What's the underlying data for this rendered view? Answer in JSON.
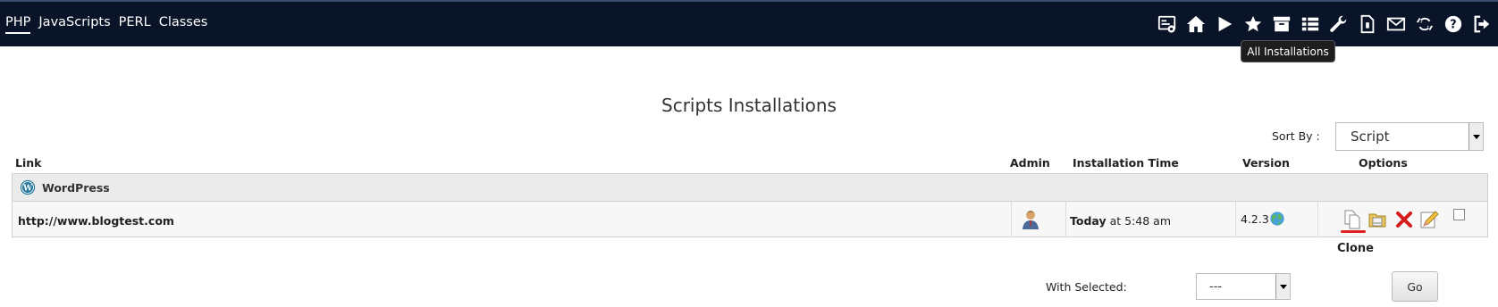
{
  "nav": {
    "tabs": [
      {
        "label": "PHP",
        "active": true
      },
      {
        "label": "JavaScripts",
        "active": false
      },
      {
        "label": "PERL",
        "active": false
      },
      {
        "label": "Classes",
        "active": false
      }
    ],
    "icons": [
      "dashboard-icon",
      "home-icon",
      "play-icon",
      "star-icon",
      "archive-icon",
      "list-icon",
      "wrench-icon",
      "file-icon",
      "mail-icon",
      "refresh-icon",
      "help-icon",
      "logout-icon"
    ],
    "colors": {
      "bar": "#0a1428"
    }
  },
  "tooltip": "All Installations",
  "page": {
    "title": "Scripts Installations"
  },
  "sort": {
    "label": "Sort By :",
    "value": "Script"
  },
  "table": {
    "headers": {
      "link": "Link",
      "admin": "Admin",
      "time": "Installation Time",
      "version": "Version",
      "options": "Options"
    },
    "group": "WordPress",
    "row": {
      "link": "http://www.blogtest.com",
      "time_bold": "Today",
      "time_rest": " at 5:48 am",
      "version": "4.2.3"
    }
  },
  "clone_label": "Clone",
  "bulk": {
    "label": "With Selected:",
    "value": "---",
    "go": "Go"
  }
}
